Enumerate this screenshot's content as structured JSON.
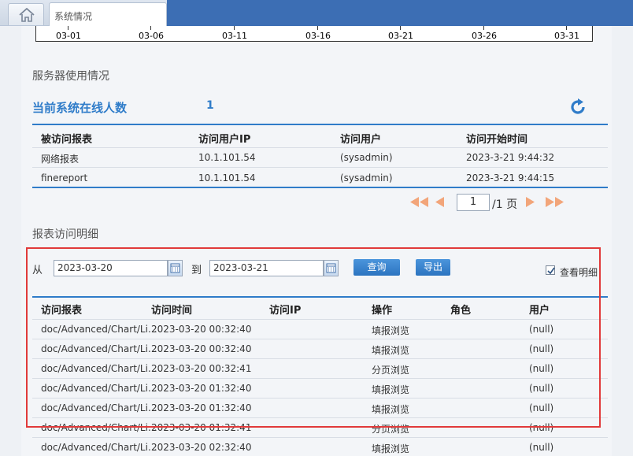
{
  "tabs": {
    "home_icon": "home-icon",
    "active_tab": "系统情况"
  },
  "chart": {
    "ticks": [
      "03-01",
      "03-06",
      "03-11",
      "03-16",
      "03-21",
      "03-26",
      "03-31"
    ]
  },
  "server": {
    "section_title": "服务器使用情况",
    "online_label": "当前系统在线人数",
    "online_count": "1",
    "refresh_icon": "refresh-icon",
    "columns": [
      "被访问报表",
      "访问用户IP",
      "访问用户",
      "访问开始时间"
    ],
    "rows": [
      [
        "网络报表",
        "10.1.101.54",
        "(sysadmin)",
        "2023-3-21 9:44:32"
      ],
      [
        "finereport",
        "10.1.101.54",
        "(sysadmin)",
        "2023-3-21 9:44:15"
      ]
    ],
    "pagination": {
      "page": "1",
      "total": "/1 页"
    }
  },
  "detail": {
    "section_title": "报表访问明细",
    "from_label": "从",
    "from_date": "2023-03-20",
    "to_label": "到",
    "to_date": "2023-03-21",
    "query_button": "查询",
    "export_button": "导出",
    "show_detail_label": "查看明细",
    "show_detail_checked": true,
    "columns": [
      "访问报表",
      "访问时间",
      "访问IP",
      "操作",
      "角色",
      "用户"
    ],
    "rows": [
      [
        "doc/Advanced/Chart/Li...",
        "2023-03-20 00:32:40",
        "",
        "填报浏览",
        "",
        "(null)"
      ],
      [
        "doc/Advanced/Chart/Li...",
        "2023-03-20 00:32:40",
        "",
        "填报浏览",
        "",
        "(null)"
      ],
      [
        "doc/Advanced/Chart/Li...",
        "2023-03-20 00:32:41",
        "",
        "分页浏览",
        "",
        "(null)"
      ],
      [
        "doc/Advanced/Chart/Li...",
        "2023-03-20 01:32:40",
        "",
        "填报浏览",
        "",
        "(null)"
      ],
      [
        "doc/Advanced/Chart/Li...",
        "2023-03-20 01:32:40",
        "",
        "填报浏览",
        "",
        "(null)"
      ],
      [
        "doc/Advanced/Chart/Li...",
        "2023-03-20 01:32:41",
        "",
        "分页浏览",
        "",
        "(null)"
      ],
      [
        "doc/Advanced/Chart/Li...",
        "2023-03-20 02:32:40",
        "",
        "填报浏览",
        "",
        "(null)"
      ]
    ]
  },
  "colors": {
    "accent": "#2f7cc9",
    "frame_red": "#e13a3a",
    "arrow_orange": "#f2a57a"
  }
}
